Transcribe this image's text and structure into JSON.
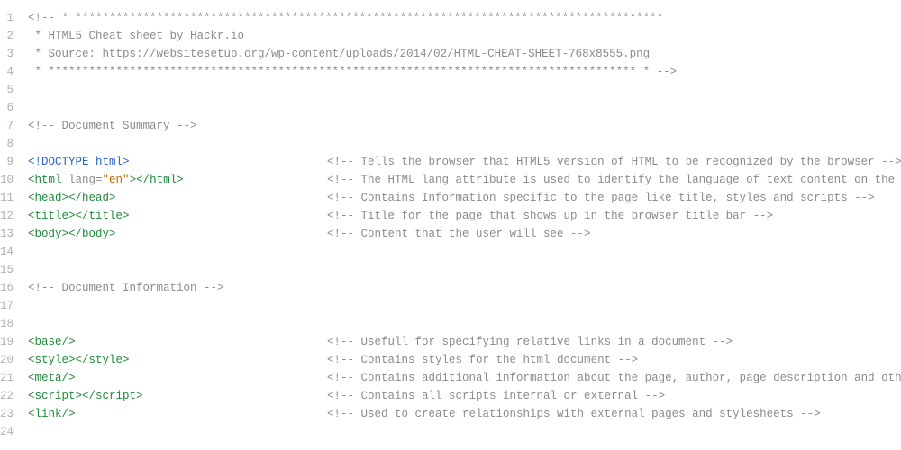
{
  "lines": [
    {
      "n": 1,
      "c1": [
        {
          "cls": "cmt",
          "t": "<!-- * ***************************************************************************************"
        }
      ]
    },
    {
      "n": 2,
      "c1": [
        {
          "cls": "cmt",
          "t": " * HTML5 Cheat sheet by Hackr.io"
        }
      ]
    },
    {
      "n": 3,
      "c1": [
        {
          "cls": "cmt",
          "t": " * Source: https://websitesetup.org/wp-content/uploads/2014/02/HTML-CHEAT-SHEET-768x8555.png"
        }
      ]
    },
    {
      "n": 4,
      "c1": [
        {
          "cls": "cmt",
          "t": " * *************************************************************************************** * -->"
        }
      ]
    },
    {
      "n": 5,
      "c1": []
    },
    {
      "n": 6,
      "c1": []
    },
    {
      "n": 7,
      "c1": [
        {
          "cls": "cmt",
          "t": "<!-- Document Summary -->"
        }
      ]
    },
    {
      "n": 8,
      "c1": []
    },
    {
      "n": 9,
      "c1": [
        {
          "cls": "doctype",
          "t": "<!DOCTYPE html>"
        }
      ],
      "c2": [
        {
          "cls": "cmt",
          "t": "<!-- Tells the browser that HTML5 version of HTML to be recognized by the browser -->"
        }
      ]
    },
    {
      "n": 10,
      "c1": [
        {
          "cls": "tag",
          "t": "<html "
        },
        {
          "cls": "attr",
          "t": "lang="
        },
        {
          "cls": "str",
          "t": "\"en\""
        },
        {
          "cls": "tag",
          "t": "></html>"
        }
      ],
      "c2": [
        {
          "cls": "cmt",
          "t": "<!-- The HTML lang attribute is used to identify the language of text content on the web. This in"
        }
      ]
    },
    {
      "n": 11,
      "c1": [
        {
          "cls": "tag",
          "t": "<head></head>"
        }
      ],
      "c2": [
        {
          "cls": "cmt",
          "t": "<!-- Contains Information specific to the page like title, styles and scripts -->"
        }
      ]
    },
    {
      "n": 12,
      "c1": [
        {
          "cls": "tag",
          "t": "<title></title>"
        }
      ],
      "c2": [
        {
          "cls": "cmt",
          "t": "<!-- Title for the page that shows up in the browser title bar -->"
        }
      ]
    },
    {
      "n": 13,
      "c1": [
        {
          "cls": "tag",
          "t": "<body></body>"
        }
      ],
      "c2": [
        {
          "cls": "cmt",
          "t": "<!-- Content that the user will see -->"
        }
      ]
    },
    {
      "n": 14,
      "c1": []
    },
    {
      "n": 15,
      "c1": []
    },
    {
      "n": 16,
      "c1": [
        {
          "cls": "cmt",
          "t": "<!-- Document Information -->"
        }
      ]
    },
    {
      "n": 17,
      "c1": []
    },
    {
      "n": 18,
      "c1": []
    },
    {
      "n": 19,
      "c1": [
        {
          "cls": "tag",
          "t": "<base/>"
        }
      ],
      "c2": [
        {
          "cls": "cmt",
          "t": "<!-- Usefull for specifying relative links in a document -->"
        }
      ]
    },
    {
      "n": 20,
      "c1": [
        {
          "cls": "tag",
          "t": "<style></style>"
        }
      ],
      "c2": [
        {
          "cls": "cmt",
          "t": "<!-- Contains styles for the html document -->"
        }
      ]
    },
    {
      "n": 21,
      "c1": [
        {
          "cls": "tag",
          "t": "<meta/>"
        }
      ],
      "c2": [
        {
          "cls": "cmt",
          "t": "<!-- Contains additional information about the page, author, page description and other hidden pa"
        }
      ]
    },
    {
      "n": 22,
      "c1": [
        {
          "cls": "tag",
          "t": "<script></script>"
        }
      ],
      "c2": [
        {
          "cls": "cmt",
          "t": "<!-- Contains all scripts internal or external -->"
        }
      ]
    },
    {
      "n": 23,
      "c1": [
        {
          "cls": "tag",
          "t": "<link/>"
        }
      ],
      "c2": [
        {
          "cls": "cmt",
          "t": "<!-- Used to create relationships with external pages and stylesheets -->"
        }
      ]
    },
    {
      "n": 24,
      "c1": []
    }
  ]
}
